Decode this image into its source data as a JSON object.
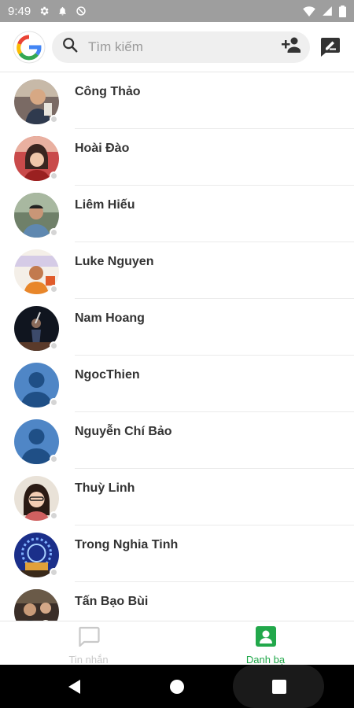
{
  "status_bar": {
    "time": "9:49"
  },
  "header": {
    "logo_icon": "google-g-logo",
    "search": {
      "placeholder": "Tìm kiếm",
      "search_icon": "search-icon",
      "add_contact_icon": "person-add-icon"
    },
    "compose_icon": "compose-icon"
  },
  "contacts": [
    {
      "name": "Công Thảo",
      "avatar_icon": "avatar-photo"
    },
    {
      "name": "Hoài Đào",
      "avatar_icon": "avatar-photo"
    },
    {
      "name": "Liêm Hiếu",
      "avatar_icon": "avatar-photo"
    },
    {
      "name": "Luke Nguyen",
      "avatar_icon": "avatar-photo"
    },
    {
      "name": "Nam Hoang",
      "avatar_icon": "avatar-photo"
    },
    {
      "name": "NgocThien",
      "avatar_icon": "default-avatar"
    },
    {
      "name": "Nguyễn Chí Bảo",
      "avatar_icon": "default-avatar"
    },
    {
      "name": "Thuỳ Linh",
      "avatar_icon": "avatar-photo"
    },
    {
      "name": "Trong Nghia Tinh",
      "avatar_icon": "avatar-photo"
    },
    {
      "name": "Tấn Bạo Bùi",
      "avatar_icon": "avatar-photo"
    }
  ],
  "bottom_nav": {
    "messages": {
      "label": "Tin nhắn",
      "icon": "chat-icon",
      "active": false
    },
    "contacts": {
      "label": "Danh bạ",
      "icon": "contacts-icon",
      "active": true
    }
  },
  "colors": {
    "accent": "#22a84b",
    "status_bar": "#9e9e9e",
    "presence_offline": "#d5d5d5"
  }
}
